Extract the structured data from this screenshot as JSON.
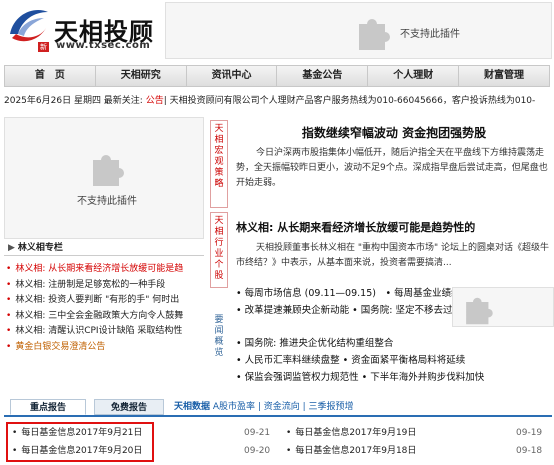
{
  "header": {
    "logo_text": "天相投顾",
    "logo_badge": "新",
    "logo_url": "www.txsec.com",
    "plugin_top_text": "不支持此插件"
  },
  "nav": [
    "首　页",
    "天相研究",
    "资讯中心",
    "基金公告",
    "个人理财",
    "财富管理"
  ],
  "datebar": {
    "prefix": "2025年6月26日 星期四 最新关注: ",
    "highlight": "公告",
    "rest": "| 天相投资顾问有限公司个人理财产品客户服务热线为010-66045666，客户投诉热线为010-"
  },
  "plugin_left_text": "不支持此插件",
  "column": {
    "title": "林义相专栏",
    "items": [
      {
        "text": "林义相: 从长期来看经济增长放缓可能是趋",
        "style": "red"
      },
      {
        "text": "林义相: 注册制是足够宽松的一种手段",
        "style": "normal"
      },
      {
        "text": "林义相: 投资人要判断 \"有形的手\" 何时出",
        "style": "normal"
      },
      {
        "text": "林义相: 三中全会金融政策大方向令人鼓舞",
        "style": "normal"
      },
      {
        "text": "林义相: 清醒认识CPI设计缺陷 采取结构性",
        "style": "normal"
      },
      {
        "text": "黄金白银交易澄清公告",
        "style": "orange"
      }
    ]
  },
  "vtags": {
    "macro": [
      "天",
      "相",
      "宏",
      "观",
      "策",
      "略"
    ],
    "industry": [
      "天",
      "相",
      "行",
      "业",
      "个",
      "股"
    ],
    "overview": [
      "要",
      "闻",
      "概",
      "览"
    ]
  },
  "main": {
    "headline": "指数继续窄幅波动 资金抱团强势股",
    "para1": "今日沪深两市股指集体小幅低开，随后沪指全天在平盘线下方维持震荡走势，全天振幅较昨日更小，波动不足9个点。深成指早盘后尝试走高，但尾盘也开始走弱。",
    "sub_headline": "林义相: 从长期来看经济增长放缓可能是趋势性的",
    "para2": "天相投顾董事长林义相在 \"重构中国资本市场\" 论坛上的圆桌对话《超级牛市终结？》中表示，从基本面来说，投资者需要搞清...",
    "news": [
      "• 每周市场信息 (09.11—09.15)　• 每周基金业绩统计(9.18)",
      "• 改革提速兼顾央企新动能 • 国务院: 坚定不移去过剩产能",
      "• 国务院: 推进央企优化结构重组整合",
      "• 人民币汇率料继续盘整 • 资金面紧平衡格局料将延续",
      "• 保监会强调监管权力规范性 • 下半年海外并购步伐料加快"
    ],
    "plugin_mid_text": "不支持此插件"
  },
  "bottom": {
    "tab_reports": "重点报告",
    "tab_free": "免费报告",
    "data_title": "天相数据",
    "data_links": "A股市盈率 | 资金流向 | 三季报预增",
    "reports_left": [
      {
        "title": "每日基金信息2017年9月21日",
        "date": "09-21"
      },
      {
        "title": "每日基金信息2017年9月20日",
        "date": "09-20"
      }
    ],
    "reports_right": [
      {
        "title": "每日基金信息2017年9月19日",
        "date": "09-19"
      },
      {
        "title": "每日基金信息2017年9月18日",
        "date": "09-18"
      }
    ]
  },
  "colors": {
    "accent_red": "#d40000",
    "link_blue": "#1a5fa8",
    "highlight_box": "#e01010"
  },
  "icons": [
    "logo-swoosh-icon",
    "puzzle-plugin-icon",
    "bullet-icon"
  ]
}
